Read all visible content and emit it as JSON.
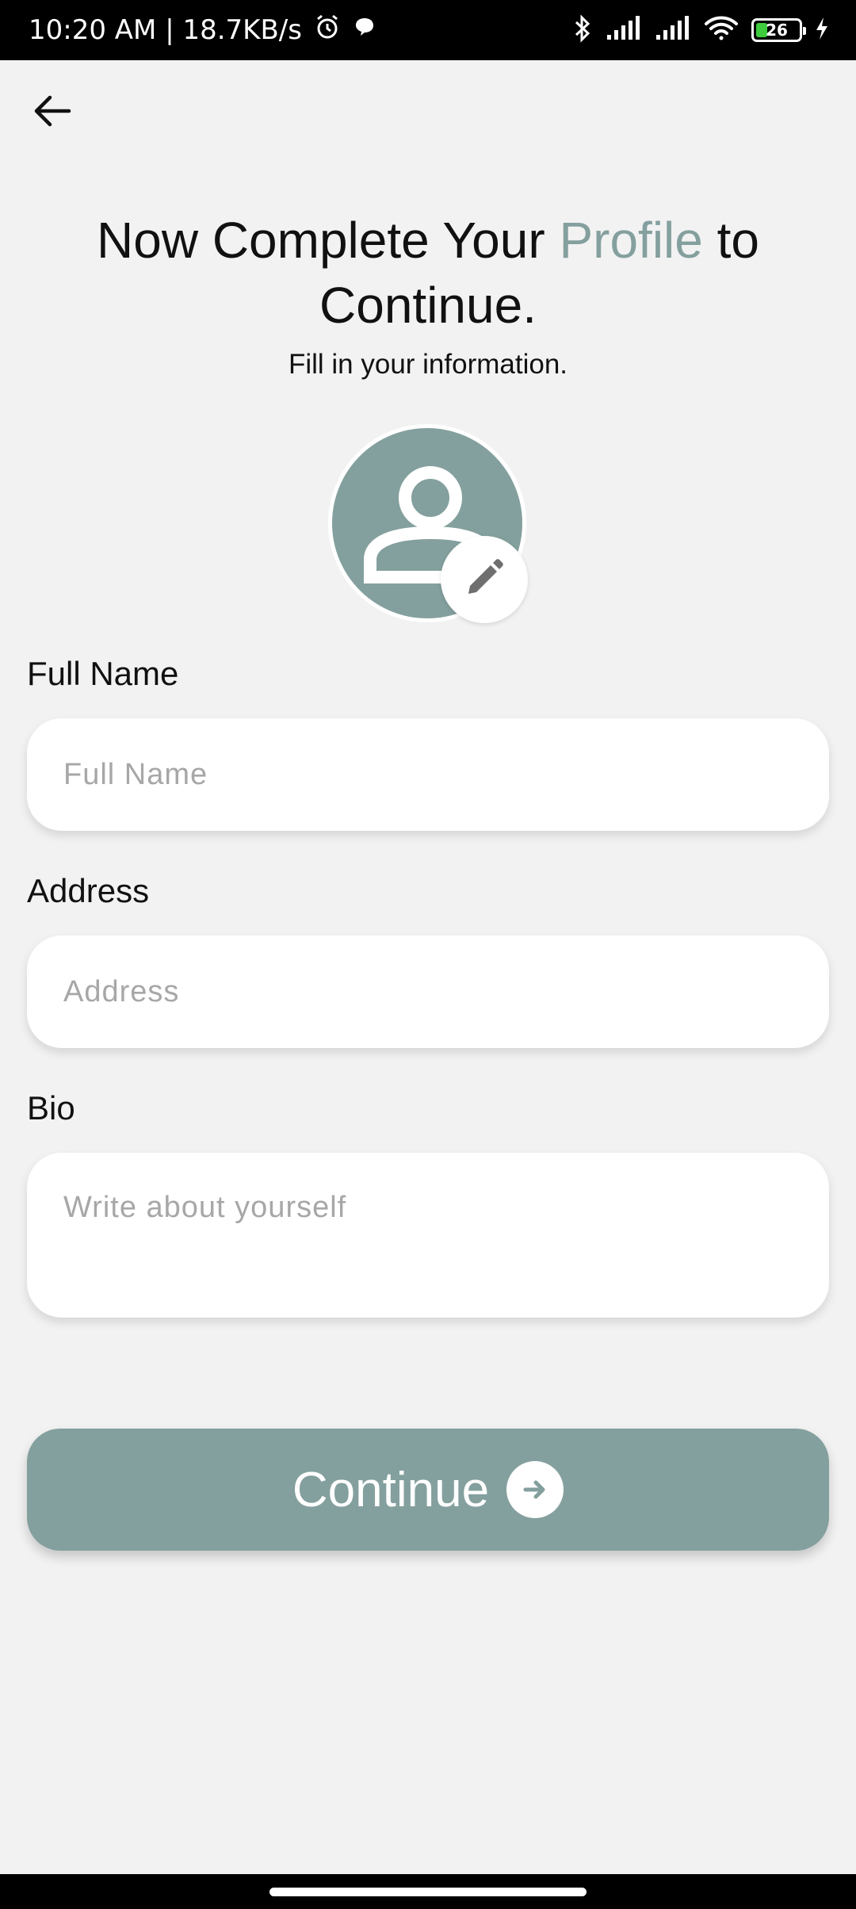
{
  "status_bar": {
    "time_speed": "10:20 AM | 18.7KB/s",
    "battery_level": "26",
    "battery_fraction": 0.26,
    "icons": [
      "alarm-icon",
      "chat-bubble-icon",
      "bluetooth-icon",
      "signal-icon",
      "signal-icon",
      "wifi-icon",
      "battery-icon",
      "charging-icon"
    ]
  },
  "header": {
    "back_icon": "arrow-left-icon",
    "title_part1": "Now Complete Your ",
    "title_accent": "Profile",
    "title_part2": " to Continue.",
    "subtitle": "Fill in your information."
  },
  "avatar": {
    "icon": "person-icon",
    "edit_icon": "pencil-icon"
  },
  "form": {
    "full_name": {
      "label": "Full Name",
      "placeholder": "Full Name"
    },
    "address": {
      "label": "Address",
      "placeholder": "Address"
    },
    "bio": {
      "label": "Bio",
      "placeholder": "Write about yourself"
    }
  },
  "continue_button": {
    "label": "Continue",
    "icon": "arrow-right-circle-icon"
  },
  "colors": {
    "accent": "#84a09e",
    "background": "#f2f2f2",
    "field": "#ffffff",
    "placeholder": "#a7a7a7"
  }
}
